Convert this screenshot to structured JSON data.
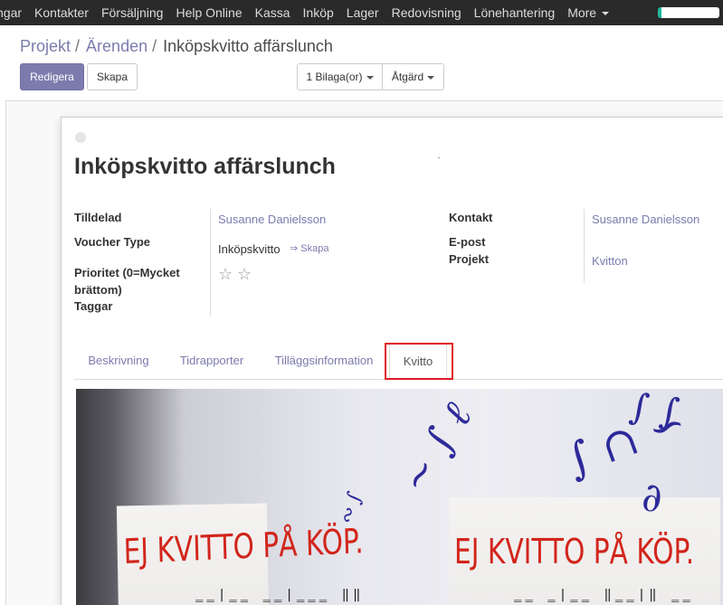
{
  "topnav": {
    "items": [
      "ngar",
      "Kontakter",
      "Försäljning",
      "Help Online",
      "Kassa",
      "Inköp",
      "Lager",
      "Redovisning",
      "Lönehantering",
      "More"
    ]
  },
  "breadcrumb": {
    "items": [
      "Projekt",
      "Ärenden"
    ],
    "current": "Inköpskvitto affärslunch"
  },
  "buttons": {
    "edit": "Redigera",
    "create": "Skapa",
    "attachments": "1 Bilaga(or)",
    "action": "Åtgärd"
  },
  "form": {
    "title": "Inköpskvitto affärslunch",
    "left": {
      "assigned_label": "Tilldelad",
      "assigned_value": "Susanne Danielsson",
      "voucher_label": "Voucher Type",
      "voucher_value": "Inköpskvitto",
      "voucher_create": "⇒ Skapa",
      "priority_label": "Prioritet (0=Mycket brättom)",
      "tags_label": "Taggar"
    },
    "right": {
      "contact_label": "Kontakt",
      "contact_value": "Susanne Danielsson",
      "email_label": "E-post",
      "project_label": "Projekt",
      "project_value": "Kvitton"
    }
  },
  "tabs": [
    "Beskrivning",
    "Tidrapporter",
    "Tilläggsinformation",
    "Kvitto"
  ],
  "active_tab": "Kvitto",
  "receipt": {
    "stamp_left": "EJ KVITTO PÅ KÖP.",
    "stamp_right": "EJ KVITTO PÅ KÖP."
  },
  "colors": {
    "accent": "#7c7bad",
    "nav_bg": "#2b2a2b",
    "highlight": "#e01b24",
    "stamp_red": "#d2251c"
  }
}
